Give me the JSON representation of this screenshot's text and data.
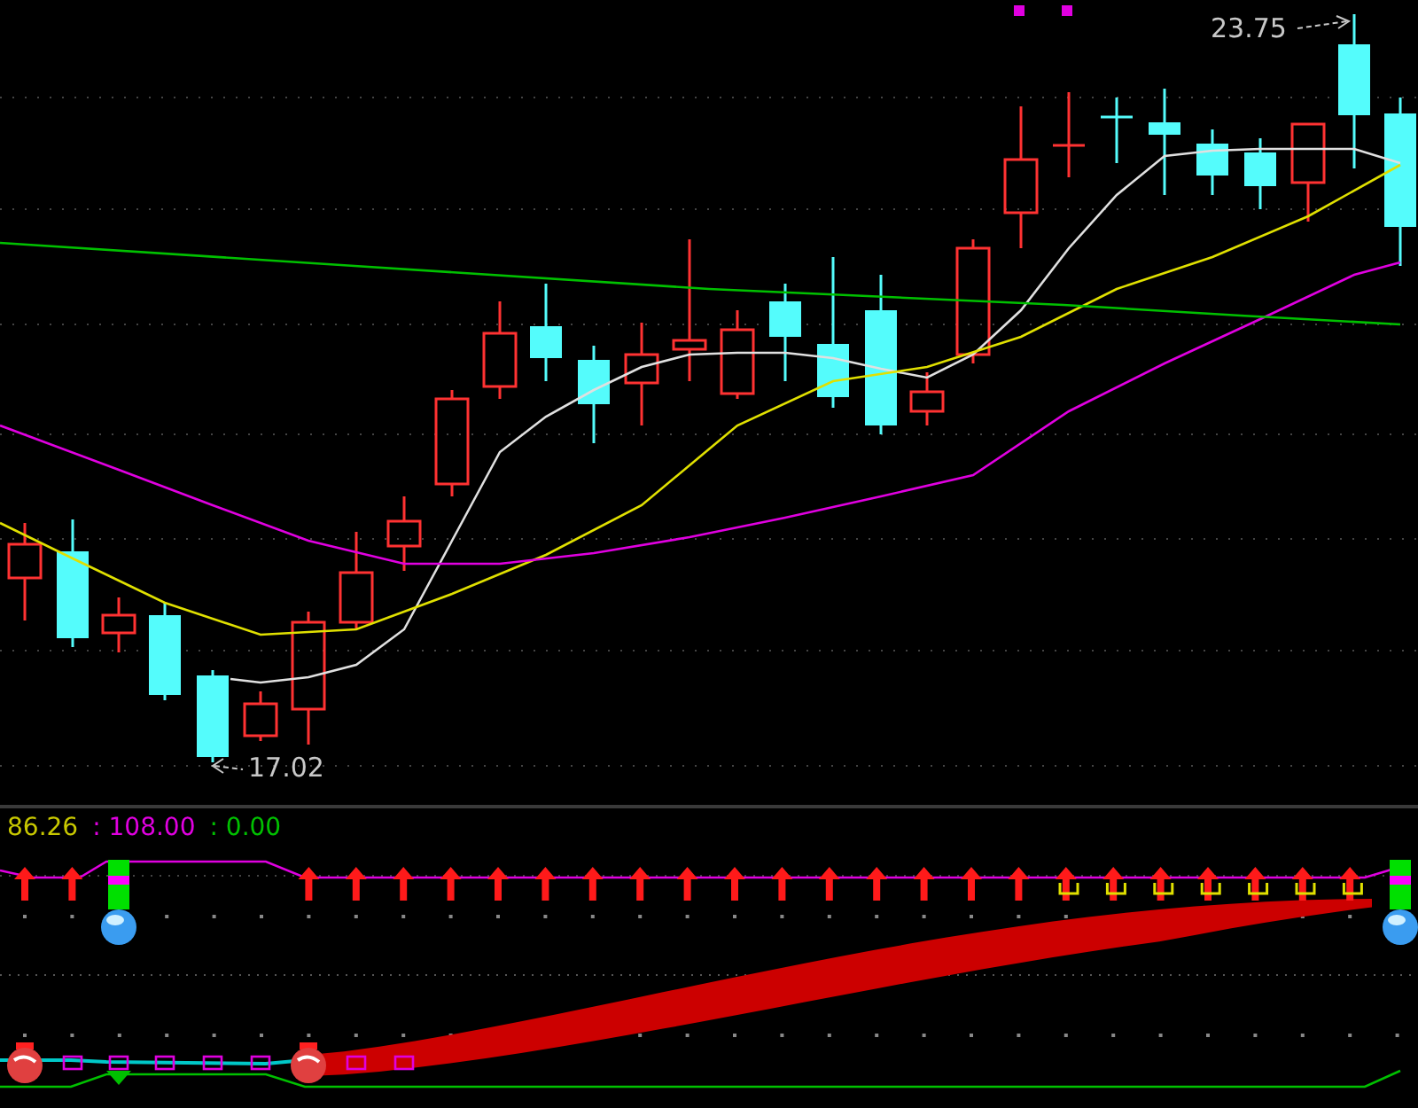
{
  "price_panel": {
    "high_label": "23.75",
    "low_label": "17.02"
  },
  "indicator_panel": {
    "readings": [
      {
        "text": "86.26",
        "color": "#c8c800"
      },
      {
        "text": ": 108.00",
        "color": "#e000e0"
      },
      {
        "text": ": 0.00",
        "color": "#00c000"
      }
    ]
  }
}
